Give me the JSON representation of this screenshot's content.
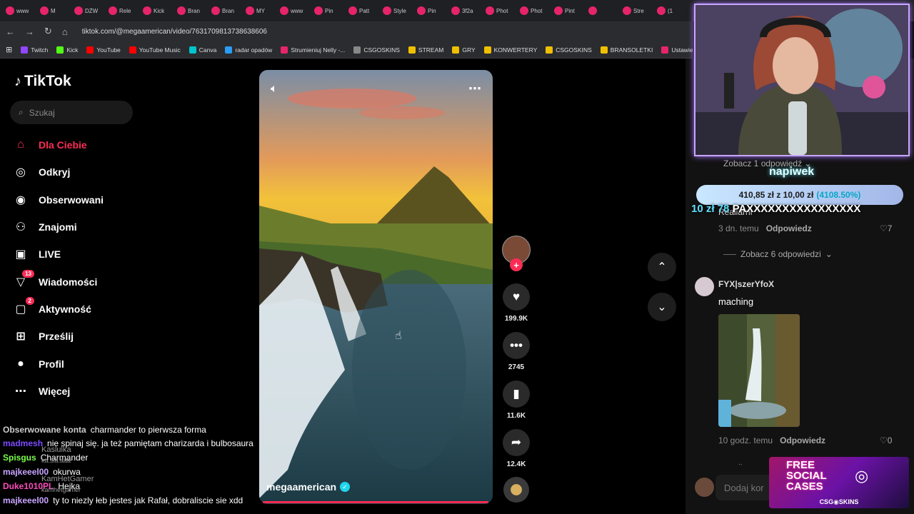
{
  "browser": {
    "tabs": [
      "www",
      "M",
      "DŻW",
      "Rele",
      "Kick",
      "Bran",
      "Bran",
      "MY",
      "www",
      "Pin",
      "Patt",
      "Style",
      "Pin",
      "3f2a",
      "Phot",
      "Phot",
      "Pint",
      "",
      "Stre",
      "(1"
    ],
    "url": "tiktok.com/@megaamerican/video/7631709813738638606",
    "bookmarks": [
      "Twitch",
      "Kick",
      "YouTube",
      "YouTube Music",
      "Canva",
      "radar opadów",
      "Strumieniuj Nelly -...",
      "CSGOSKINS",
      "STREAM",
      "GRY",
      "KONWERTERY",
      "CSGOSKINS",
      "BRANSOLETKI",
      "Ustawienia strumien..."
    ]
  },
  "sidebar": {
    "logo": "TikTok",
    "search_placeholder": "Szukaj",
    "items": [
      {
        "label": "Dla Ciebie",
        "icon": "home-icon",
        "active": true
      },
      {
        "label": "Odkryj",
        "icon": "compass-icon"
      },
      {
        "label": "Obserwowani",
        "icon": "following-icon"
      },
      {
        "label": "Znajomi",
        "icon": "friends-icon"
      },
      {
        "label": "LIVE",
        "icon": "live-icon"
      },
      {
        "label": "Wiadomości",
        "icon": "messages-icon",
        "badge": "13"
      },
      {
        "label": "Aktywność",
        "icon": "activity-icon",
        "badge": "2"
      },
      {
        "label": "Prześlij",
        "icon": "upload-icon"
      },
      {
        "label": "Profil",
        "icon": "profile-icon"
      },
      {
        "label": "Więcej",
        "icon": "more-icon"
      }
    ]
  },
  "video": {
    "author": "megaamerican",
    "likes": "199.9K",
    "comments": "2745",
    "saves": "11.6K",
    "shares": "12.4K",
    "progress": 1.0
  },
  "comments": {
    "view_replies_1": "Zobacz 1 odpowiedź",
    "partial_text": "Realiarni",
    "c1_time": "3 dn. temu",
    "reply": "Odpowiedz",
    "c1_likes": "7",
    "view_replies_6": "Zobacz 6 odpowiedzi",
    "c2_user": "FYX|szerYfoX",
    "c2_text": "maching",
    "c2_time": "10 godz. temu",
    "c2_likes": "0",
    "add_comment": "Dodaj kor",
    "dots": ".."
  },
  "overlay": {
    "tip_title": "napiwek",
    "tip_current": "410,85 zł",
    "tip_of": "z",
    "tip_goal": "10,00 zł",
    "tip_pct": "(4108.50%)",
    "scroll_amount": "10 zł",
    "scroll_num": "78",
    "scroll_text": "PAXXXXXXXXXXXXXXXX",
    "promo_title_1": "FREE",
    "promo_title_2": "SOCIAL",
    "promo_title_3": "CASES",
    "promo_brand": "CSG◉SKINS"
  },
  "chat": [
    {
      "user": "Obserwowane konta",
      "text": "charmander to pierwsza forma",
      "color": "#cccccc"
    },
    {
      "user": "madmesh",
      "text": "nie spinaj się. ja też pamiętam charizarda i bulbosaura",
      "color": "#7b4bff"
    },
    {
      "user": "Spisgus",
      "text": "Charmander",
      "color": "#7bff4b"
    },
    {
      "user": "majkeeel00",
      "text": "okurwa",
      "color": "#c9a5ff"
    },
    {
      "user": "Duke1010PL",
      "text": "Hejka",
      "color": "#ff4bbd"
    },
    {
      "user": "majkeeel00",
      "text": "ty to niezly łeb jestes jak Rafał, dobraliscie sie xdd",
      "color": "#c9a5ff"
    }
  ],
  "chat_ghosts": [
    "Kaslulka",
    "ka.sla.aaa",
    "KamHetGamer",
    "kamhetgamer"
  ],
  "colors": {
    "accent": "#fe2c55",
    "verified": "#20d5ec"
  }
}
